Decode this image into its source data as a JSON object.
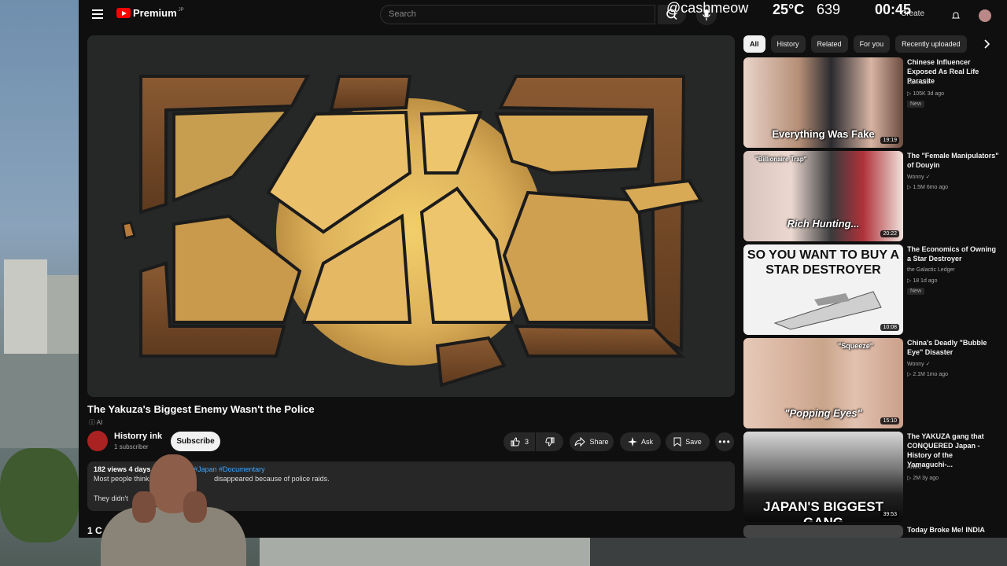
{
  "header": {
    "logo_text": "Premium",
    "logo_sup": "JP",
    "search_placeholder": "Search",
    "create_label": "Create"
  },
  "stream_overlay": {
    "handle": "@cashmeow",
    "temperature": "25°C",
    "count": "639",
    "clock": "00:45"
  },
  "video": {
    "title": "The Yakuza's Biggest Enemy Wasn't the Police",
    "ai_badge": "AI",
    "channel_name": "Historry ink",
    "channel_subs": "1 subscriber",
    "subscribe_label": "Subscribe",
    "like_count": "3",
    "share_label": "Share",
    "ask_label": "Ask",
    "save_label": "Save",
    "views_date": "182 views  4 days",
    "tags": "za #Japan #Documentary",
    "desc_line1_start": "Most people think",
    "desc_line1_end": "disappeared because of police raids.",
    "desc_line2": "They didn't",
    "comments_head": "1 C"
  },
  "chips": [
    {
      "label": "All",
      "active": true
    },
    {
      "label": "History",
      "active": false
    },
    {
      "label": "Related",
      "active": false
    },
    {
      "label": "For you",
      "active": false
    },
    {
      "label": "Recently uploaded",
      "active": false
    }
  ],
  "recommendations": [
    {
      "title": "Chinese Influencer Exposed As Real Life Parasite",
      "channel": "Dark Silk",
      "stats": "▷ 105K  3d ago",
      "badge": "New",
      "duration": "19:19",
      "thumb_text": "Everything Was Fake"
    },
    {
      "title": "The \"Female Manipulators\" of Douyin",
      "channel": "Wonny",
      "stats": "▷ 1.5M  6mo ago",
      "badge": "",
      "duration": "20:22",
      "thumb_text": "Rich Hunting...",
      "thumb_tag": "\"Billionaire Trap\""
    },
    {
      "title": "The Economics of Owning a Star Destroyer",
      "channel": "the Galactic Ledger",
      "stats": "▷ 18  1d ago",
      "badge": "New",
      "duration": "10:08",
      "thumb_text": "SO YOU WANT TO BUY A STAR DESTROYER"
    },
    {
      "title": "China's Deadly \"Bubble Eye\" Disaster",
      "channel": "Wonny",
      "stats": "▷ 2.1M  1mo ago",
      "badge": "",
      "duration": "15:10",
      "thumb_text": "\"Popping Eyes\"",
      "thumb_tag": "\"Squeeze\""
    },
    {
      "title": "The YAKUZA gang that CONQUERED Japan - History of the Yamaguchi-...",
      "channel": "ANIKI",
      "stats": "▷ 2M  3y ago",
      "badge": "",
      "duration": "39:53",
      "thumb_text": "JAPAN'S BIGGEST GANG"
    },
    {
      "title": "Today Broke Me! INDIA",
      "channel": "",
      "stats": "",
      "badge": "",
      "duration": "",
      "thumb_text": ""
    }
  ]
}
